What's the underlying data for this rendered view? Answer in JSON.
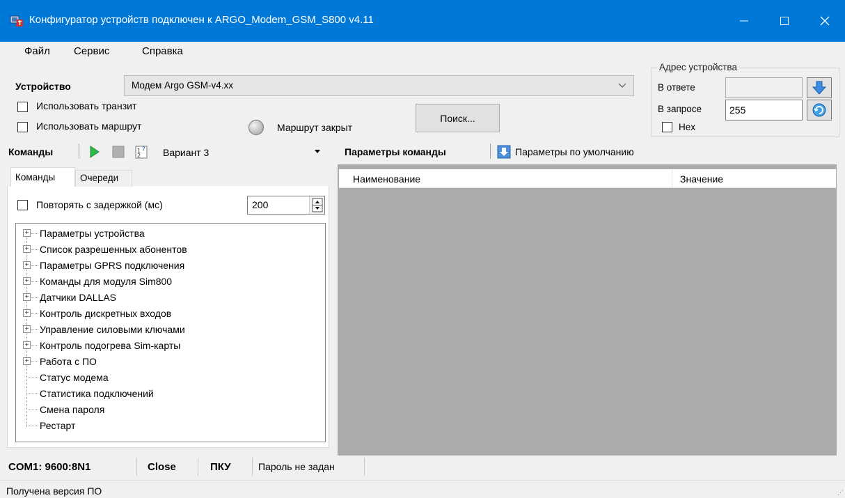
{
  "window": {
    "title": "Конфигуратор устройств подключен к ARGO_Modem_GSM_S800 v4.11",
    "accent": "#0078d7"
  },
  "menu": {
    "items": [
      {
        "label": "Файл"
      },
      {
        "label": "Сервис"
      },
      {
        "label": "Справка"
      }
    ]
  },
  "device": {
    "label": "Устройство",
    "selected": "Модем Argo GSM-v4.xx",
    "use_transit": "Использовать транзит",
    "use_route": "Использовать маршрут",
    "route_status": "Маршрут закрыт",
    "search_button": "Поиск..."
  },
  "address": {
    "title": "Адрес устройства",
    "in_response_label": "В ответе",
    "in_response_value": "",
    "in_request_label": "В запросе",
    "in_request_value": "255",
    "hex_label": "Hex"
  },
  "commands_toolbar": {
    "label": "Команды",
    "variant": "Вариант 3"
  },
  "params_toolbar": {
    "label": "Параметры команды",
    "defaults": "Параметры по умолчанию"
  },
  "tabs": [
    {
      "label": "Команды",
      "active": true
    },
    {
      "label": "Очереди",
      "active": false
    }
  ],
  "repeat": {
    "label": "Повторять с задержкой (мс)",
    "value": "200"
  },
  "tree": {
    "nodes": [
      {
        "label": "Параметры устройства",
        "expandable": true
      },
      {
        "label": "Список разрешенных абонентов",
        "expandable": true
      },
      {
        "label": "Параметры GPRS подключения",
        "expandable": true
      },
      {
        "label": "Команды для модуля Sim800",
        "expandable": true
      },
      {
        "label": "Датчики DALLAS",
        "expandable": true
      },
      {
        "label": "Контроль дискретных входов",
        "expandable": true
      },
      {
        "label": "Управление силовыми ключами",
        "expandable": true
      },
      {
        "label": "Контроль подогрева Sim-карты",
        "expandable": true
      },
      {
        "label": "Работа с ПО",
        "expandable": true
      },
      {
        "label": "Статус модема",
        "expandable": false
      },
      {
        "label": "Статистика подключений",
        "expandable": false
      },
      {
        "label": "Смена пароля",
        "expandable": false
      },
      {
        "label": "Рестарт",
        "expandable": false
      }
    ]
  },
  "grid": {
    "col_name": "Наименование",
    "col_value": "Значение"
  },
  "status": {
    "port": "COM1: 9600:8N1",
    "state": "Close",
    "mode": "ПКУ",
    "password": "Пароль не задан",
    "message": "Получена версия ПО"
  }
}
